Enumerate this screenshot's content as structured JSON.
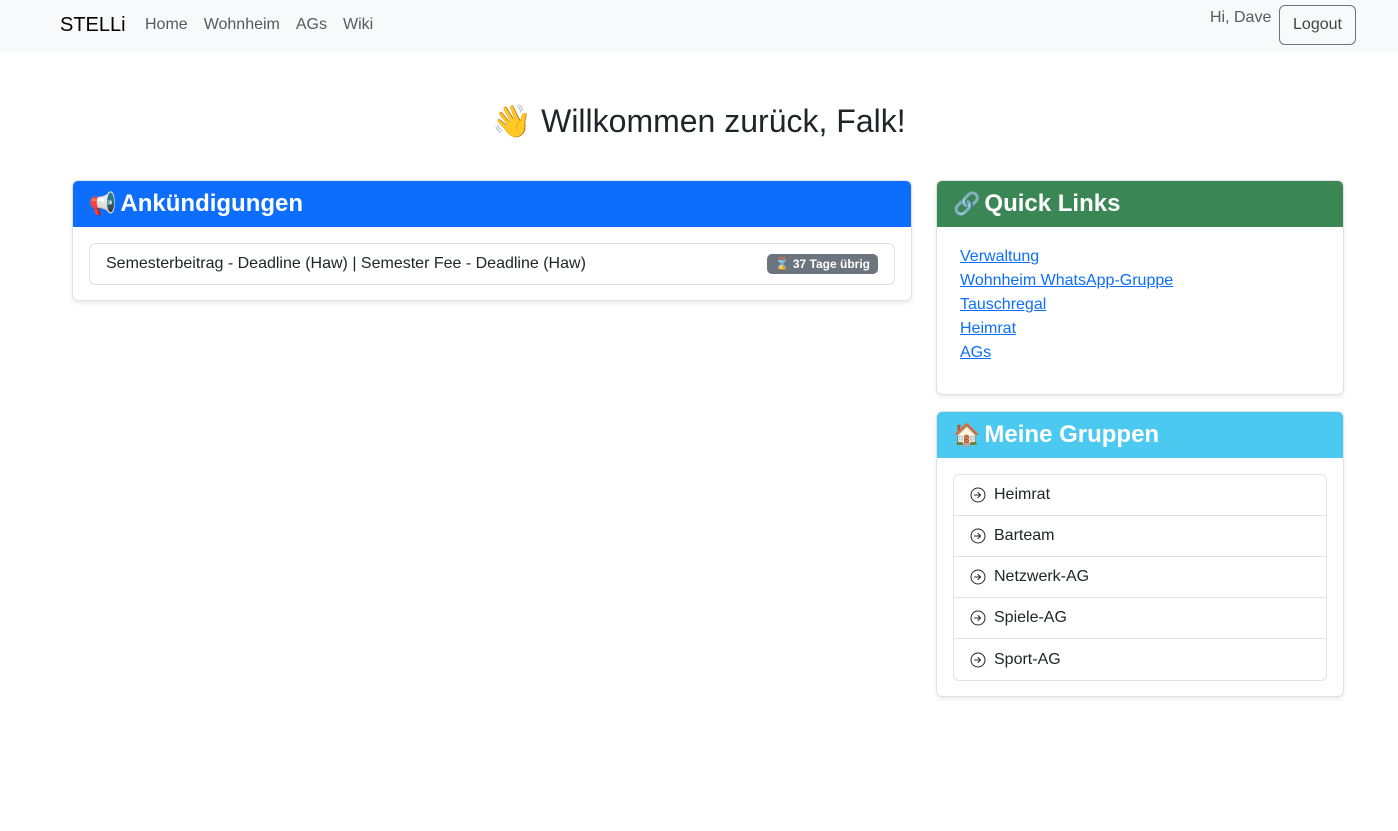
{
  "navbar": {
    "brand": "STELLi",
    "links": [
      "Home",
      "Wohnheim",
      "AGs",
      "Wiki"
    ],
    "greeting": "Hi, Dave",
    "logout_label": "Logout"
  },
  "welcome": {
    "emoji": "👋",
    "text": "Willkommen zurück, Falk!"
  },
  "announcements": {
    "icon": "📢",
    "title": "Ankündigungen",
    "items": [
      {
        "text": "Semesterbeitrag - Deadline (Haw) | Semester Fee - Deadline (Haw)",
        "badge": "⌛ 37 Tage übrig"
      }
    ]
  },
  "quick_links": {
    "icon": "🔗",
    "title": "Quick Links",
    "items": [
      "Verwaltung",
      "Wohnheim WhatsApp-Gruppe",
      "Tauschregal",
      "Heimrat",
      "AGs"
    ]
  },
  "groups": {
    "icon": "🏠",
    "title": "Meine Gruppen",
    "items": [
      "Heimrat",
      "Barteam",
      "Netzwerk-AG",
      "Spiele-AG",
      "Sport-AG"
    ]
  },
  "colors": {
    "primary": "#0d6efd",
    "success": "#3a8655",
    "info": "#4cc9f0",
    "badge": "#6c757d"
  }
}
